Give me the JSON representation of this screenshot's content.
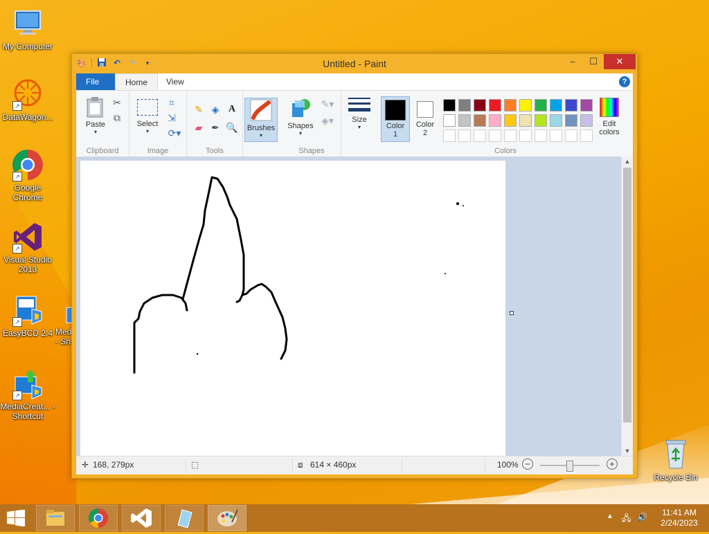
{
  "desktop": {
    "icons": [
      {
        "label": "My Computer"
      },
      {
        "label": "DataWagon..."
      },
      {
        "label": "Google Chrome"
      },
      {
        "label": "Visual Studio 2013"
      },
      {
        "label": "EasyBCD 2.4"
      },
      {
        "label": "Med - Sh"
      },
      {
        "label": "MediaCreat... - Shortcut"
      },
      {
        "label": "Recycle Bin"
      }
    ]
  },
  "window": {
    "title": "Untitled - Paint",
    "controls": {
      "minimize": "–",
      "maximize": "☐",
      "close": "✕"
    }
  },
  "tabs": {
    "file": "File",
    "home": "Home",
    "view": "View"
  },
  "ribbon": {
    "clipboard": {
      "label": "Clipboard",
      "paste": "Paste"
    },
    "image": {
      "label": "Image",
      "select": "Select"
    },
    "tools": {
      "label": "Tools"
    },
    "brushes": {
      "label": "Brushes"
    },
    "shapes": {
      "label": "Shapes",
      "button": "Shapes"
    },
    "size": {
      "label": "Size"
    },
    "colors": {
      "label": "Colors",
      "color1": "Color 1",
      "color2": "Color 2",
      "edit": "Edit colors",
      "row1": [
        "#000000",
        "#7f7f7f",
        "#880015",
        "#ed1c24",
        "#ff7f27",
        "#fff200",
        "#22b14c",
        "#00a2e8",
        "#3f48cc",
        "#a349a4"
      ],
      "row2": [
        "#ffffff",
        "#c3c3c3",
        "#b97a57",
        "#ffaec9",
        "#ffc90e",
        "#efe4b0",
        "#b5e61d",
        "#99d9ea",
        "#7092be",
        "#c8bfe7"
      ]
    }
  },
  "status": {
    "cursor": "168, 279px",
    "size": "614 × 460px",
    "zoom": "100%"
  },
  "taskbar": {
    "time": "11:41 AM",
    "date": "2/24/2023"
  }
}
